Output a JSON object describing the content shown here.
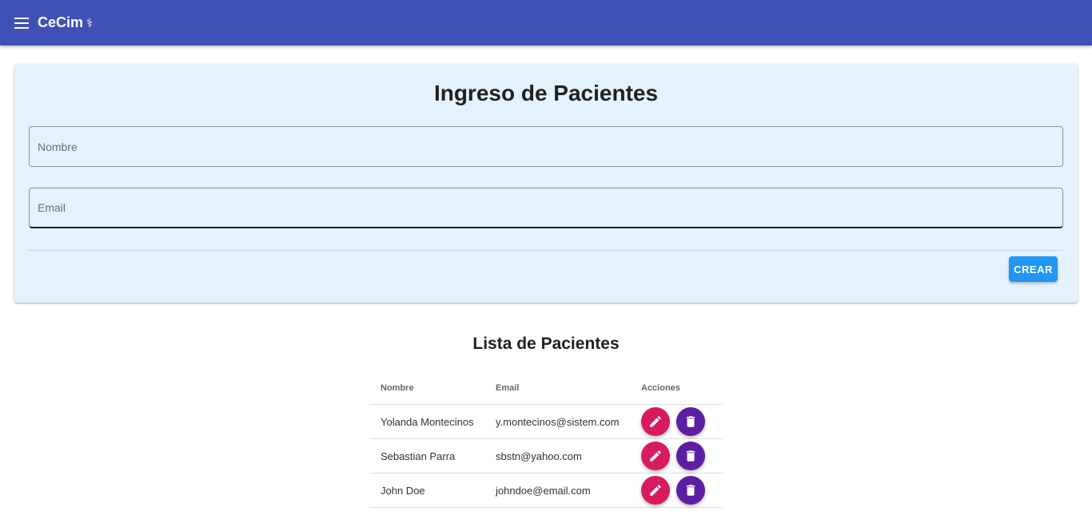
{
  "appbar": {
    "title": "CeCim",
    "brand_icon": "⚕",
    "menu_icon": "menu-icon",
    "color": "#3f51b5"
  },
  "form": {
    "title": "Ingreso de Pacientes",
    "name_placeholder": "Nombre",
    "email_placeholder": "Email",
    "name_value": "",
    "email_value": "",
    "submit_label": "CREAR",
    "background": "#e3f2fd",
    "submit_color": "#2196f3"
  },
  "list": {
    "title": "Lista de Pacientes",
    "headers": [
      "Nombre",
      "Email",
      "Acciones"
    ],
    "rows": [
      {
        "name": "Yolanda Montecinos",
        "email": "y.montecinos@sistem.com"
      },
      {
        "name": "Sebastian Parra",
        "email": "sbstn@yahoo.com"
      },
      {
        "name": "John Doe",
        "email": "johndoe@email.com"
      }
    ],
    "edit_icon": "pencil-icon",
    "delete_icon": "trash-icon",
    "edit_color": "#d81b60",
    "delete_color": "#5e1ea3"
  }
}
